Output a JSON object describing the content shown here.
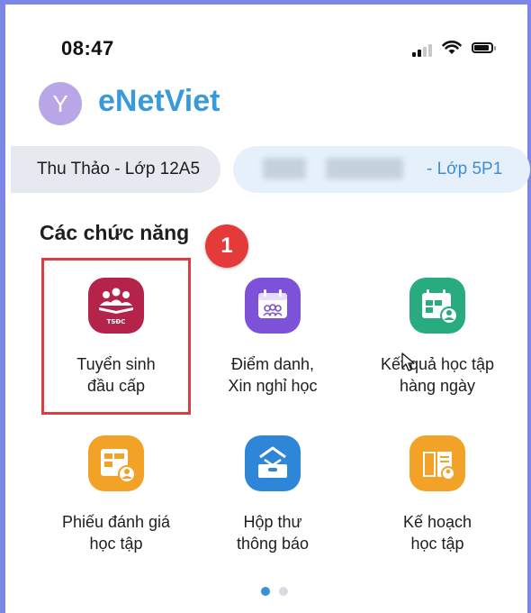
{
  "status_bar": {
    "time": "08:47"
  },
  "header": {
    "avatar_initial": "Y",
    "app_name": "eNetViet"
  },
  "classes": [
    {
      "label": "Thu Thảo - Lớp 12A5"
    },
    {
      "label": "- Lớp 5P1"
    }
  ],
  "features": {
    "section_title": "Các chức năng",
    "step_badge": "1",
    "items": [
      {
        "line1": "Tuyển sinh",
        "line2": "đầu cấp",
        "icon": "tsdc-icon",
        "icon_text": "TSĐC",
        "color": "#b5234b"
      },
      {
        "line1": "Điểm danh,",
        "line2": "Xin nghỉ học",
        "icon": "attendance-calendar-icon",
        "color": "#7d52d8"
      },
      {
        "line1": "Kết quả học tập",
        "line2": "hàng ngày",
        "icon": "daily-results-calendar-icon",
        "color": "#27ab7f"
      },
      {
        "line1": "Phiếu đánh giá",
        "line2": "học tập",
        "icon": "evaluation-form-icon",
        "color": "#f2a227"
      },
      {
        "line1": "Hộp thư",
        "line2": "thông báo",
        "icon": "mailbox-icon",
        "color": "#2e86d8"
      },
      {
        "line1": "Kế hoạch",
        "line2": "học tập",
        "icon": "study-plan-book-icon",
        "color": "#f2a227"
      }
    ]
  },
  "pagination": {
    "active_color": "#3a8fd9",
    "inactive_color": "#d7dbe2"
  }
}
